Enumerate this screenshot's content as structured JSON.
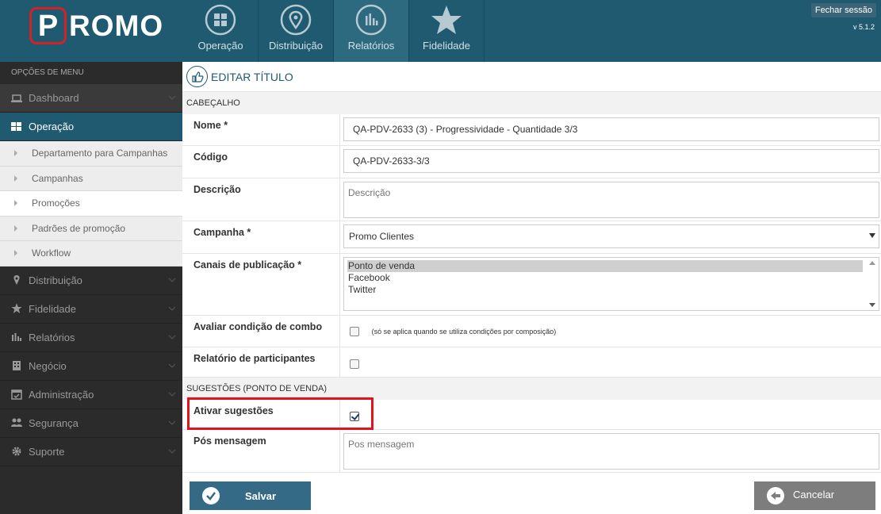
{
  "brand": {
    "logo_initial": "P",
    "logo_rest": "ROMO",
    "accent": "#d62027",
    "primary": "#1f5a70"
  },
  "header": {
    "nav": [
      {
        "label": "Operação",
        "icon": "grid-icon"
      },
      {
        "label": "Distribuição",
        "icon": "map-pin-icon"
      },
      {
        "label": "Relatórios",
        "icon": "bar-chart-icon"
      },
      {
        "label": "Fidelidade",
        "icon": "star-icon"
      }
    ],
    "active_nav": "Relatórios",
    "logout_label": "Fechar sessão",
    "version": "v 5.1.2"
  },
  "sidebar": {
    "title": "OPÇÕES DE MENU",
    "items": [
      {
        "label": "Dashboard",
        "icon": "laptop-icon"
      },
      {
        "label": "Operação",
        "icon": "grid-icon"
      },
      {
        "label": "Distribuição",
        "icon": "map-pin-icon"
      },
      {
        "label": "Fidelidade",
        "icon": "star-icon"
      },
      {
        "label": "Relatórios",
        "icon": "bar-chart-icon"
      },
      {
        "label": "Negócio",
        "icon": "building-icon"
      },
      {
        "label": "Administração",
        "icon": "calendar-icon"
      },
      {
        "label": "Segurança",
        "icon": "users-icon"
      },
      {
        "label": "Suporte",
        "icon": "gear-icon"
      }
    ],
    "submenu": [
      {
        "label": "Departamento para Campanhas"
      },
      {
        "label": "Campanhas"
      },
      {
        "label": "Promoções"
      },
      {
        "label": "Padrões de promoção"
      },
      {
        "label": "Workflow"
      }
    ],
    "active_submenu": "Promoções"
  },
  "main": {
    "title": "EDITAR TÍTULO",
    "section1": "CABEÇALHO",
    "section2": "SUGESTÕES (PONTO DE VENDA)",
    "fields": {
      "nome": {
        "label": "Nome *",
        "value": "QA-PDV-2633 (3) - Progressividade - Quantidade 3/3"
      },
      "codigo": {
        "label": "Código",
        "value": "QA-PDV-2633-3/3"
      },
      "descricao": {
        "label": "Descrição",
        "placeholder": "Descrição"
      },
      "campanha": {
        "label": "Campanha *",
        "value": "Promo Clientes"
      },
      "canais": {
        "label": "Canais de publicação *",
        "options": [
          "Ponto de venda",
          "Facebook",
          "Twitter"
        ],
        "selected": "Ponto de venda"
      },
      "combo": {
        "label": "Avaliar condição de combo",
        "note": "(só se aplica quando se utiliza condições por composição)",
        "checked": false
      },
      "participantes": {
        "label": "Relatório de participantes",
        "checked": false
      },
      "sugestoes": {
        "label": "Ativar sugestões",
        "checked": true
      },
      "pos_mensagem": {
        "label": "Pós mensagem",
        "placeholder": "Pos mensagem"
      }
    },
    "save_label": "Salvar",
    "cancel_label": "Cancelar"
  }
}
